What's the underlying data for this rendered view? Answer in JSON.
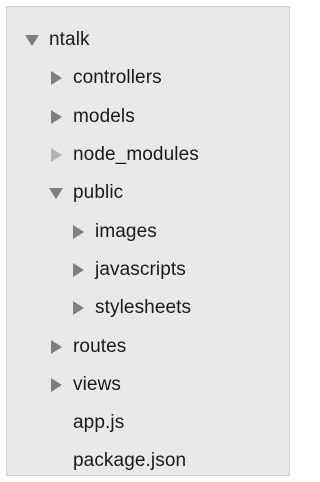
{
  "tree": {
    "rows": [
      {
        "id": "ntalk",
        "label": "ntalk",
        "depth": 0,
        "state": "expanded",
        "icon": "triangle-down-icon"
      },
      {
        "id": "controllers",
        "label": "controllers",
        "depth": 1,
        "state": "collapsed",
        "icon": "triangle-right-icon"
      },
      {
        "id": "models",
        "label": "models",
        "depth": 1,
        "state": "collapsed",
        "icon": "triangle-right-icon"
      },
      {
        "id": "node-modules",
        "label": "node_modules",
        "depth": 1,
        "state": "collapsed",
        "icon": "triangle-right-icon",
        "dimmed": true
      },
      {
        "id": "public",
        "label": "public",
        "depth": 1,
        "state": "expanded",
        "icon": "triangle-down-icon"
      },
      {
        "id": "images",
        "label": "images",
        "depth": 2,
        "state": "collapsed",
        "icon": "triangle-right-icon"
      },
      {
        "id": "javascripts",
        "label": "javascripts",
        "depth": 2,
        "state": "collapsed",
        "icon": "triangle-right-icon"
      },
      {
        "id": "stylesheets",
        "label": "stylesheets",
        "depth": 2,
        "state": "collapsed",
        "icon": "triangle-right-icon"
      },
      {
        "id": "routes",
        "label": "routes",
        "depth": 1,
        "state": "collapsed",
        "icon": "triangle-right-icon"
      },
      {
        "id": "views",
        "label": "views",
        "depth": 1,
        "state": "collapsed",
        "icon": "triangle-right-icon"
      },
      {
        "id": "app-js",
        "label": "app.js",
        "depth": 1,
        "state": "file"
      },
      {
        "id": "package-json",
        "label": "package.json",
        "depth": 1,
        "state": "file"
      }
    ]
  },
  "colors": {
    "panel_bg": "#e9e9e9",
    "arrow": "#7f7f7f",
    "arrow_dim": "#b3b3b3",
    "text": "#1a1a1a"
  }
}
